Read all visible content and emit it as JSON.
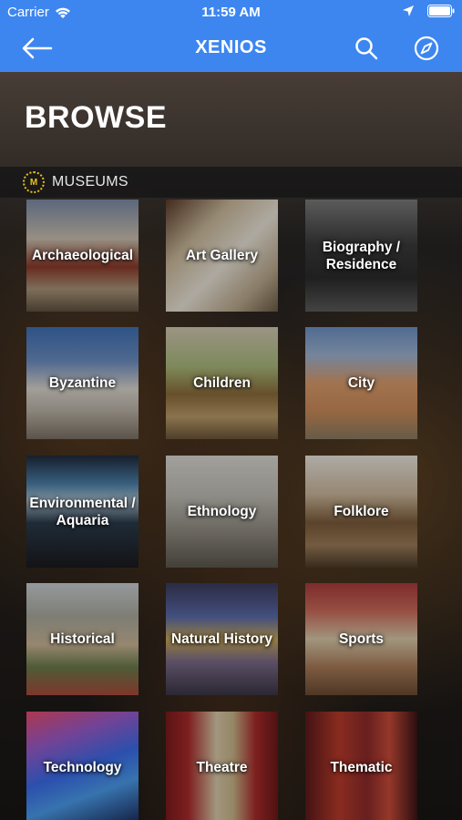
{
  "status_bar": {
    "carrier": "Carrier",
    "time": "11:59 AM"
  },
  "nav": {
    "title": "XENIOS"
  },
  "page": {
    "title": "BROWSE"
  },
  "section": {
    "badge": "M",
    "label": "MUSEUMS",
    "badge_color": "#e8c21a"
  },
  "colors": {
    "header_blue": "#3d86f0"
  },
  "categories": [
    {
      "label": "Archaeological"
    },
    {
      "label": "Art Gallery"
    },
    {
      "label": "Biography / Residence"
    },
    {
      "label": "Byzantine"
    },
    {
      "label": "Children"
    },
    {
      "label": "City"
    },
    {
      "label": "Environmental / Aquaria"
    },
    {
      "label": "Ethnology"
    },
    {
      "label": "Folklore"
    },
    {
      "label": "Historical"
    },
    {
      "label": "Natural History"
    },
    {
      "label": "Sports"
    },
    {
      "label": "Technology"
    },
    {
      "label": "Theatre"
    },
    {
      "label": "Thematic"
    }
  ]
}
